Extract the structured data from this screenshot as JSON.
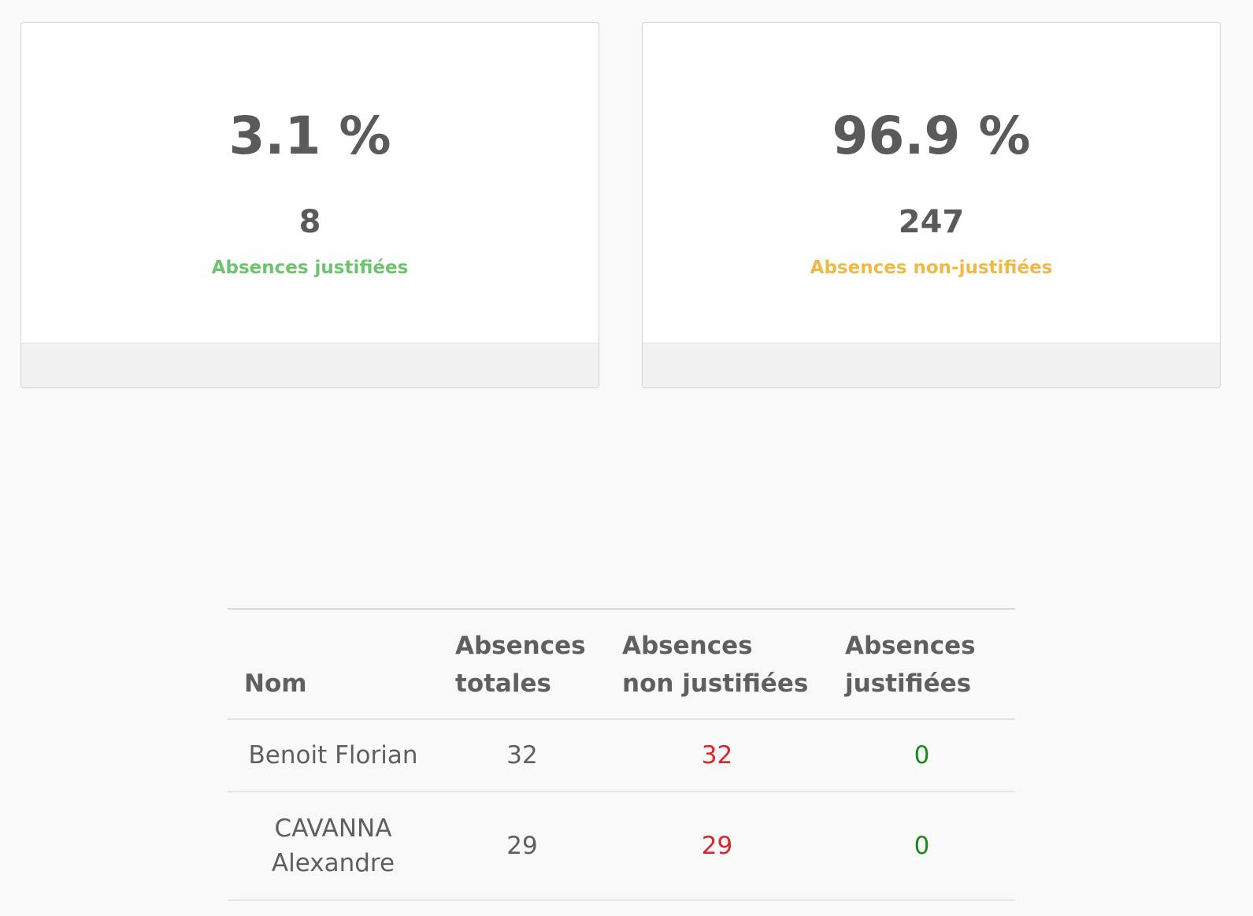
{
  "stats": {
    "justified": {
      "percent": "3.1 %",
      "count": "8",
      "label": "Absences justifiées",
      "color": "#6cc46c"
    },
    "unjustified": {
      "percent": "96.9 %",
      "count": "247",
      "label": "Absences non-justifiées",
      "color": "#efb945"
    }
  },
  "table": {
    "headers": {
      "name": "Nom",
      "total": "Absences totales",
      "unjustified": "Absences non justifiées",
      "justified": "Absences justifiées"
    },
    "rows": [
      {
        "name": "Benoit Florian",
        "total": "32",
        "unjustified": "32",
        "justified": "0"
      },
      {
        "name": "CAVANNA Alexandre",
        "total": "29",
        "unjustified": "29",
        "justified": "0"
      }
    ],
    "colors": {
      "unjustified": "#d9262d",
      "justified": "#1a8a1a"
    }
  }
}
